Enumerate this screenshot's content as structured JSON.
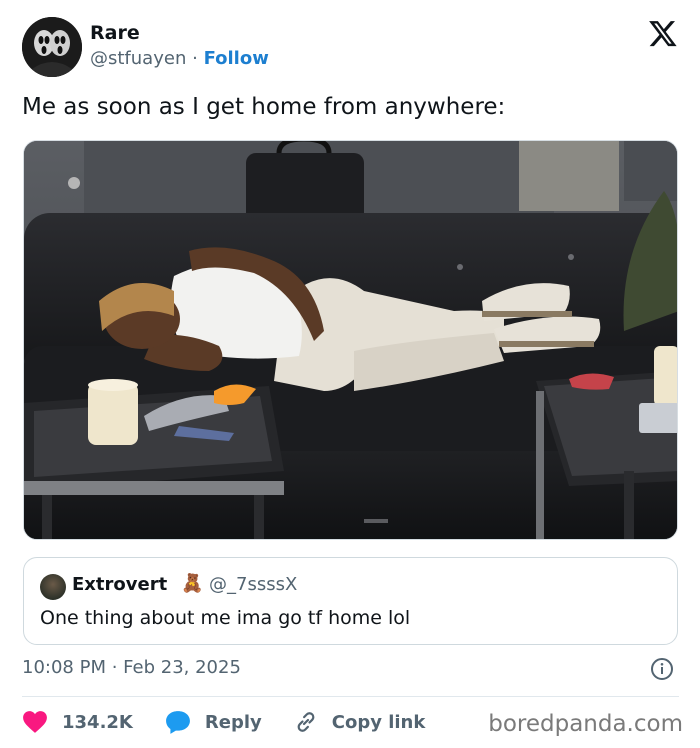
{
  "author": {
    "name": "Rare",
    "handle": "@stfuayen",
    "separator": "·",
    "follow_label": "Follow"
  },
  "tweet": {
    "text": "Me as soon as I get home from anywhere:"
  },
  "quoted_tweet": {
    "name": "Extrovert",
    "emoji": "🧸",
    "handle": "@_7ssssX",
    "text": "One thing about me ima go tf home lol"
  },
  "timestamp": "10:08 PM · Feb 23, 2025",
  "actions": {
    "likes": "134.2K",
    "reply_label": "Reply",
    "copy_link_label": "Copy link"
  },
  "watermark": "boredpanda.com",
  "colors": {
    "follow_blue": "#1d7fd0",
    "heart_pink": "#f91880",
    "reply_blue": "#1d9bf0",
    "muted_gray": "#536471"
  },
  "icons": [
    "x-logo-icon",
    "info-icon",
    "heart-icon",
    "reply-bubble-icon",
    "link-icon"
  ]
}
